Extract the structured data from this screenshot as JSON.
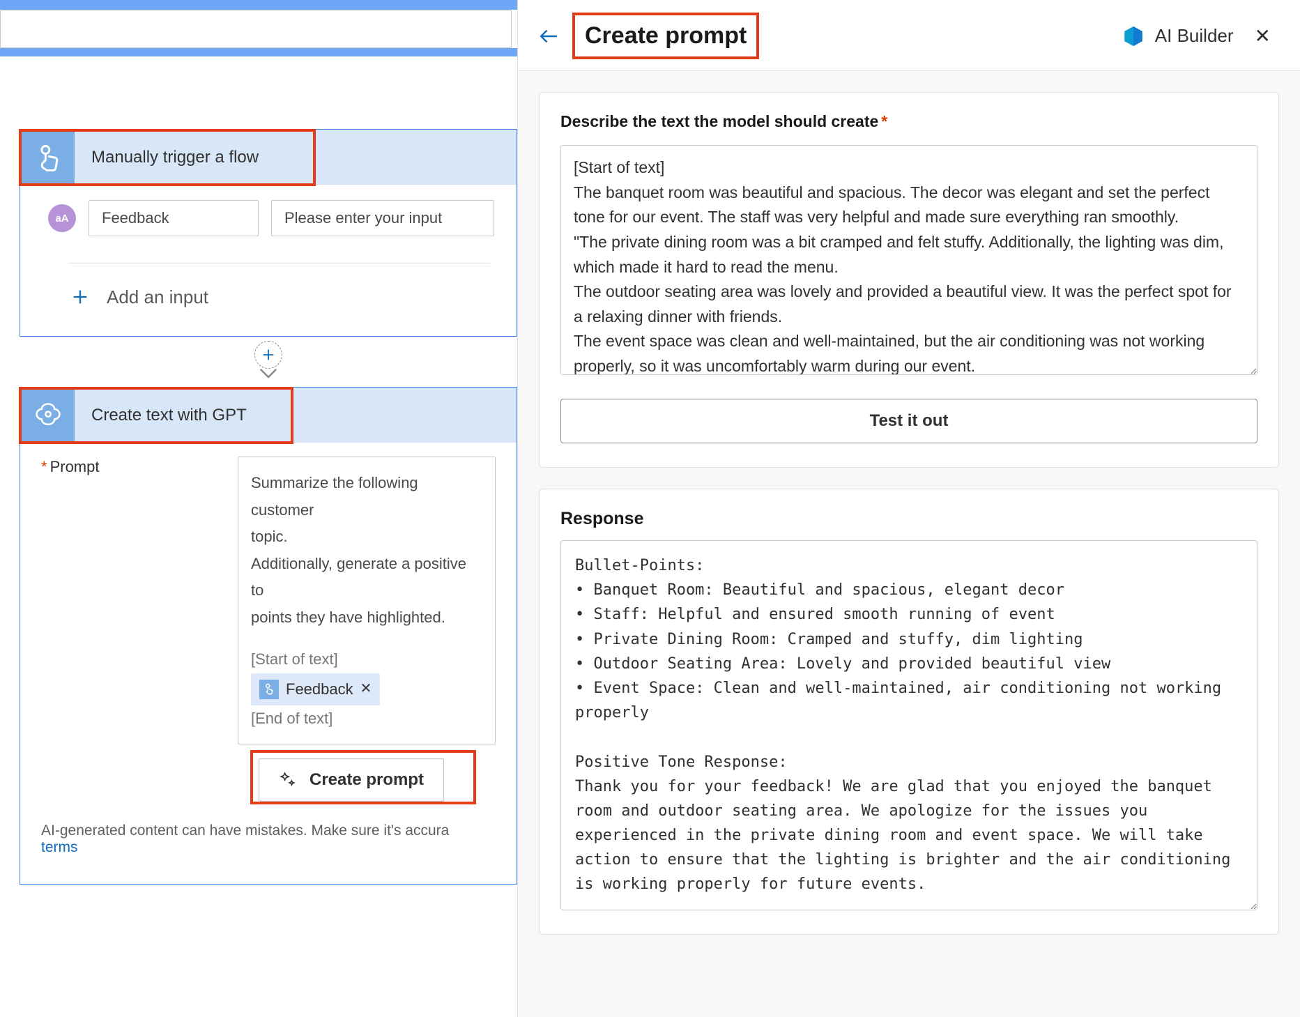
{
  "panel": {
    "title": "Create prompt",
    "brand": "AI Builder",
    "describe_label": "Describe the text the model should create",
    "describe_value": "[Start of text]\nThe banquet room was beautiful and spacious. The decor was elegant and set the perfect tone for our event. The staff was very helpful and made sure everything ran smoothly.\n\"The private dining room was a bit cramped and felt stuffy. Additionally, the lighting was dim, which made it hard to read the menu.\nThe outdoor seating area was lovely and provided a beautiful view. It was the perfect spot for a relaxing dinner with friends.\nThe event space was clean and well-maintained, but the air conditioning was not working properly, so it was uncomfortably warm during our event.",
    "test_label": "Test it out",
    "response_label": "Response",
    "response_value": "Bullet-Points:\n• Banquet Room: Beautiful and spacious, elegant decor\n• Staff: Helpful and ensured smooth running of event\n• Private Dining Room: Cramped and stuffy, dim lighting\n• Outdoor Seating Area: Lovely and provided beautiful view\n• Event Space: Clean and well-maintained, air conditioning not working properly\n\nPositive Tone Response:\nThank you for your feedback! We are glad that you enjoyed the banquet room and outdoor seating area. We apologize for the issues you experienced in the private dining room and event space. We will take action to ensure that the lighting is brighter and the air conditioning is working properly for future events."
  },
  "flow": {
    "trigger": {
      "title": "Manually trigger a flow",
      "input_name": "Feedback",
      "input_placeholder": "Please enter your input",
      "add_input": "Add an input"
    },
    "gpt": {
      "title": "Create text with GPT",
      "prompt_label": "Prompt",
      "prompt_body_line1": "Summarize the following customer",
      "prompt_body_line2": "topic.",
      "prompt_body_line3": "Additionally, generate a positive to",
      "prompt_body_line4": "points they have highlighted.",
      "start_of_text": "[Start of text]",
      "token_label": "Feedback",
      "end_of_text": "[End of text]",
      "create_prompt_btn": "Create prompt"
    },
    "disclaimer": "AI-generated content can have mistakes. Make sure it's accura",
    "terms_link": "terms"
  },
  "icons": {
    "touch": "touch-icon",
    "aA": "aA",
    "plus": "+",
    "gpt": "gpt-icon",
    "sparkle": "✦"
  }
}
